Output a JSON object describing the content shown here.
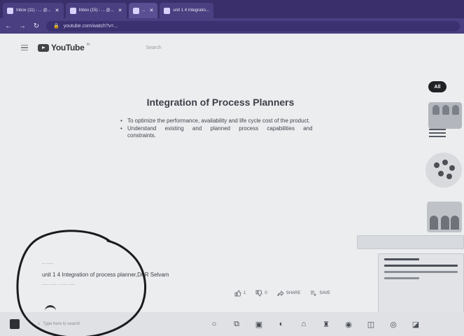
{
  "browser": {
    "tabs": [
      {
        "label": "Inbox (11) - ... @...",
        "active": false
      },
      {
        "label": "Inbox (15) - ... @...",
        "active": false
      },
      {
        "label": "...",
        "active": true
      },
      {
        "label": "unit 1 4 Integratio...",
        "active": false
      }
    ],
    "address": "youtube.com/watch?v=..."
  },
  "youtube": {
    "logo_text": "YouTube",
    "search_placeholder": "Search"
  },
  "video": {
    "slide_title": "Integration of Process Planners",
    "bullets": [
      "To optimize the performance, availability and life cycle cost of the product.",
      "Understand existing and planned process capabilities and constraints."
    ],
    "title": "unit 1 4 Integration of process planner,Dr R Selvam",
    "like_count": "1",
    "dislike_count": "0",
    "share_label": "SHARE",
    "save_label": "SAVE"
  },
  "sidebar": {
    "chip_all": "All"
  },
  "taskbar": {
    "search_placeholder": "Type here to search"
  },
  "icons": {
    "menu": "hamburger-icon",
    "like": "thumbs-up-icon",
    "dislike": "thumbs-down-icon",
    "share": "share-arrow-icon",
    "save": "playlist-add-icon"
  },
  "colors": {
    "browser_chrome": "#4a3f80",
    "page_bg": "#ecedef",
    "scribble": "#1b1b1d"
  }
}
